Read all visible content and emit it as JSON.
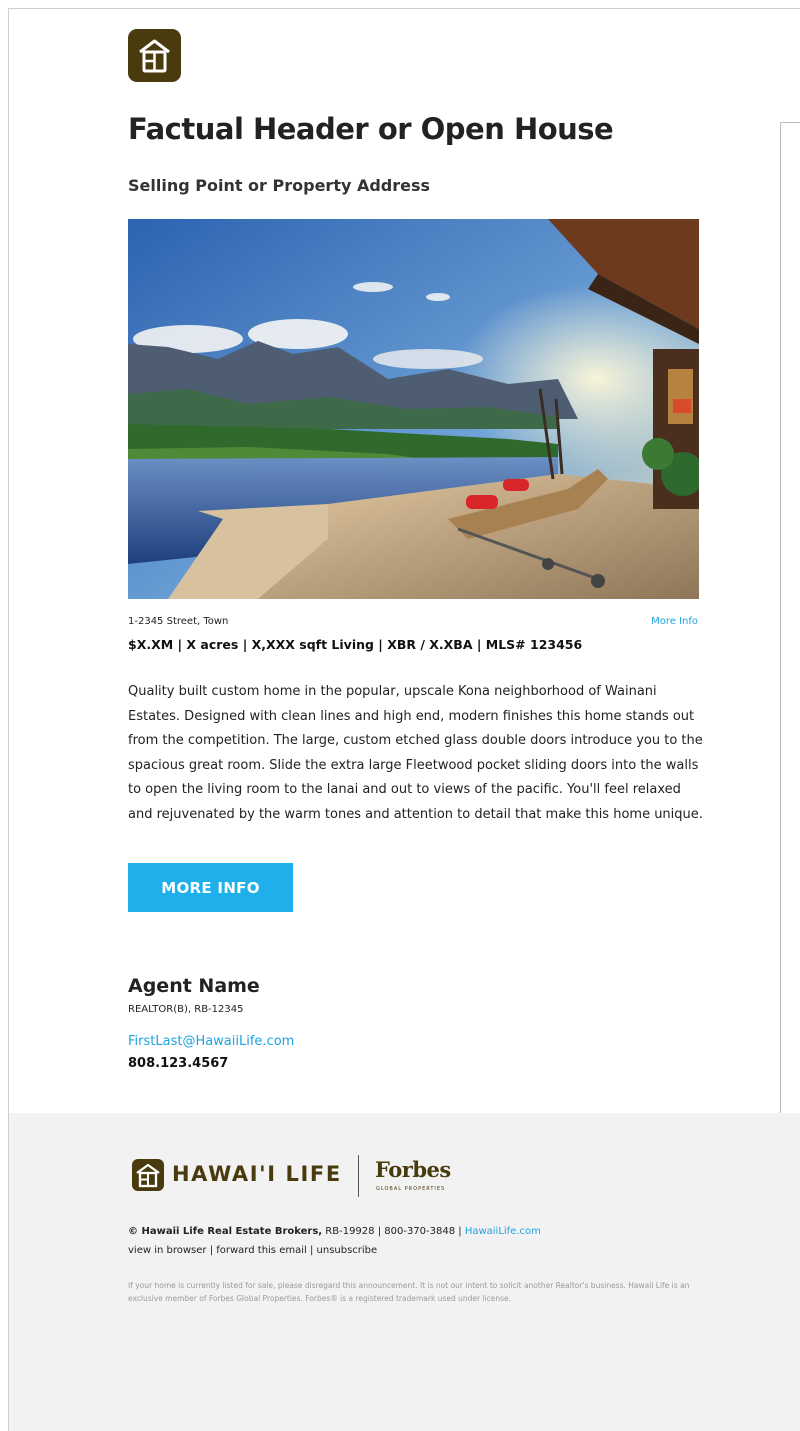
{
  "header": {
    "title": "Factual Header or Open House",
    "subtitle": "Selling Point or Property Address"
  },
  "listing": {
    "address": "1-2345 Street, Town",
    "more_info_link": "More Info",
    "specs": "$X.XM | X acres | X,XXX sqft Living | XBR / X.XBA | MLS# 123456",
    "description": "Quality built custom home in the popular, upscale Kona neighborhood of Wainani Estates. Designed with clean lines and high end, modern finishes this home stands out from the competition. The large, custom etched glass double doors introduce you to the spacious great room. Slide the extra large Fleetwood pocket sliding doors into the walls to open the living room to the lanai and out to views of the pacific. You'll feel relaxed and rejuvenated by the warm tones and attention to detail that make this home unique.",
    "cta_label": "MORE INFO"
  },
  "agent": {
    "name": "Agent Name",
    "credentials": "REALTOR(B), RB-12345",
    "email": "FirstLast@HawaiiLife.com",
    "phone": "808.123.4567"
  },
  "footer": {
    "brand": "HAWAI'I LIFE",
    "partner": "Forbes",
    "partner_sub": "GLOBAL PROPERTIES",
    "company": "© Hawaii Life Real Estate Brokers,",
    "license": " RB-19928 | 800-370-3848 | ",
    "website": "HawaiiLife.com",
    "view_in_browser": "view in browser",
    "forward": "forward this email",
    "unsubscribe": "unsubscribe",
    "separator": " | ",
    "disclaimer": "If your home is currently listed for sale, please disregard this announcement. It is not our intent to solicit another Realtor's business. Hawaii Life is an exclusive member of Forbes Global Properties. Forbes® is a registered trademark used under license."
  },
  "colors": {
    "brand_brown": "#4a3b0e",
    "accent_blue": "#1fb0ec",
    "link_blue": "#1fa3e0",
    "footer_bg": "#f2f2f2"
  },
  "icons": {
    "logo": "hawaii-life-house-icon"
  }
}
